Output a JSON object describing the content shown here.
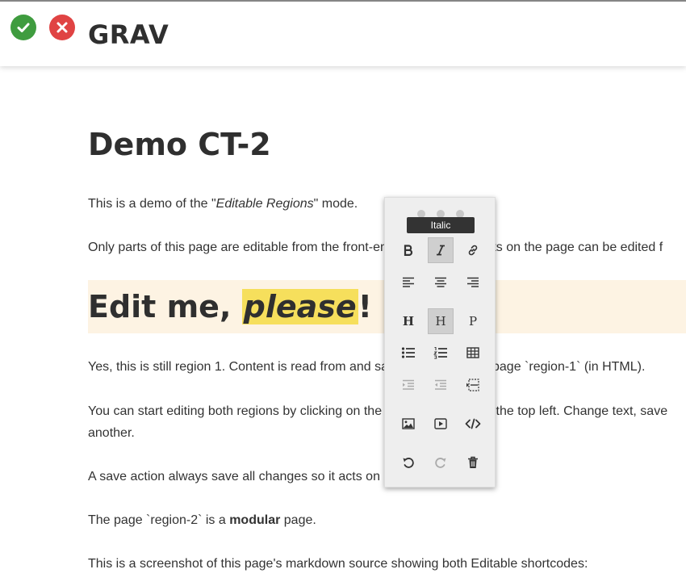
{
  "header": {
    "logo": "GRAV"
  },
  "page": {
    "title": "Demo CT-2",
    "intro_prefix": "This is a demo of the \"",
    "intro_em": "Editable Regions",
    "intro_suffix": "\" mode.",
    "p2": "Only parts of this page are editable from the front-end. To see what parts on the page can be edited f",
    "region1": {
      "heading_prefix": "Edit me, ",
      "heading_highlight": "please",
      "heading_suffix": "!"
    },
    "p3": "Yes, this is still region 1. Content is read from and saved to the regular page `region-1` (in HTML).",
    "p4_line1": "You can start editing both regions by clicking on the blue pencil icon on the top left. Change text, save",
    "p4_line2": "another.",
    "p5": "A save action always save all changes so it acts on all regions at once.",
    "p6_prefix": "The page `region-2` is a ",
    "p6_bold": "modular",
    "p6_suffix": " page.",
    "p7": "This is a screenshot of this page's markdown source showing both Editable shortcodes:"
  },
  "toolbar": {
    "tooltip": "Italic",
    "heading_label": "H",
    "subheading_label": "H",
    "paragraph_label": "P"
  },
  "colors": {
    "ok": "#3f9c3f",
    "cancel": "#e04343",
    "highlight": "#f6df5c",
    "region_bg": "#fdf3e3"
  }
}
